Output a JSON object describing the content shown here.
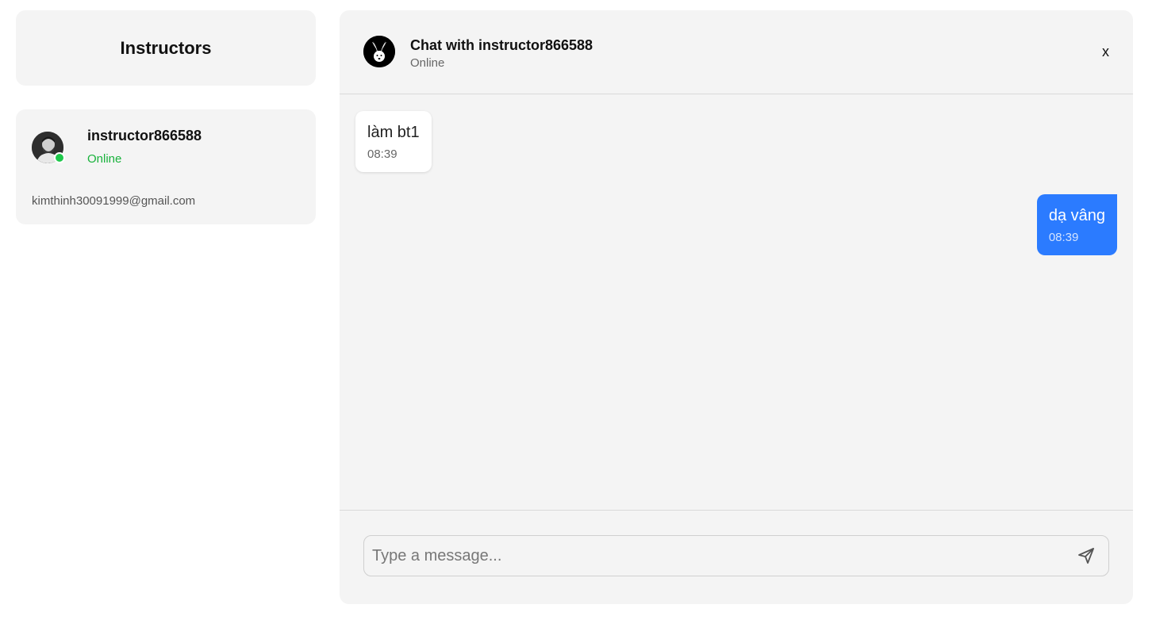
{
  "sidebar": {
    "title": "Instructors",
    "instructors": [
      {
        "name": "instructor866588",
        "status": "Online",
        "email": "kimthinh30091999@gmail.com",
        "avatar_icon": "person-avatar-icon",
        "status_color": "#19b23c"
      }
    ]
  },
  "chat": {
    "title": "Chat with instructor866588",
    "status": "Online",
    "logo_icon": "rabbit-logo-icon",
    "close_label": "x",
    "messages": [
      {
        "direction": "incoming",
        "text": "làm bt1",
        "time": "08:39"
      },
      {
        "direction": "outgoing",
        "text": "dạ vâng",
        "time": "08:39"
      }
    ],
    "input": {
      "placeholder": "Type a message...",
      "value": ""
    },
    "send_icon": "send-icon"
  },
  "colors": {
    "accent": "#2b7bff",
    "online": "#1ec84b",
    "panel_bg": "#f4f4f4"
  }
}
